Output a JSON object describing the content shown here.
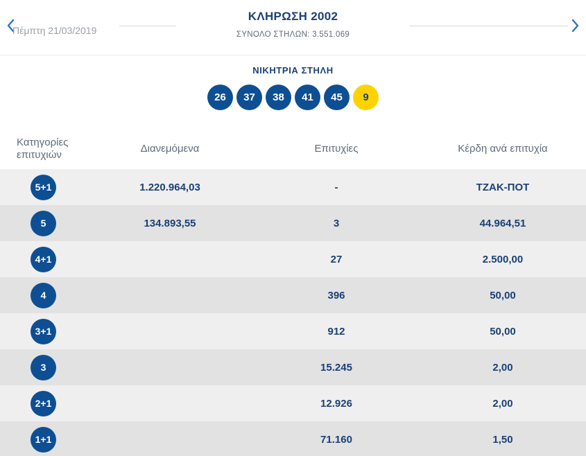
{
  "colors": {
    "navy": "#1a4076",
    "ball_blue": "#0e4f93",
    "joker_yellow": "#ffd200",
    "row_light": "#efefef",
    "row_dark": "#e2e2e2",
    "muted": "#5d6b79",
    "arrow_blue": "#2f74b9"
  },
  "header": {
    "date": "Πέμπτη 21/03/2019",
    "title": "ΚΛΗΡΩΣΗ 2002",
    "subtitle": "ΣΥΝΟΛΟ ΣΤΗΛΩΝ: 3.551.069"
  },
  "winning": {
    "title": "ΝΙΚΗΤΡΙΑ ΣΤΗΛΗ",
    "numbers": [
      "26",
      "37",
      "38",
      "41",
      "45"
    ],
    "joker": "9"
  },
  "table": {
    "headers": [
      "Κατηγορίες επιτυχιών",
      "Διανεμόμενα",
      "Επιτυχίες",
      "Κέρδη ανά επιτυχία"
    ],
    "rows": [
      {
        "category": "5+1",
        "distributed": "1.220.964,03",
        "wins": "-",
        "prize": "ΤΖΑΚ-ΠΟΤ"
      },
      {
        "category": "5",
        "distributed": "134.893,55",
        "wins": "3",
        "prize": "44.964,51"
      },
      {
        "category": "4+1",
        "distributed": "",
        "wins": "27",
        "prize": "2.500,00"
      },
      {
        "category": "4",
        "distributed": "",
        "wins": "396",
        "prize": "50,00"
      },
      {
        "category": "3+1",
        "distributed": "",
        "wins": "912",
        "prize": "50,00"
      },
      {
        "category": "3",
        "distributed": "",
        "wins": "15.245",
        "prize": "2,00"
      },
      {
        "category": "2+1",
        "distributed": "",
        "wins": "12.926",
        "prize": "2,00"
      },
      {
        "category": "1+1",
        "distributed": "",
        "wins": "71.160",
        "prize": "1,50"
      }
    ]
  }
}
